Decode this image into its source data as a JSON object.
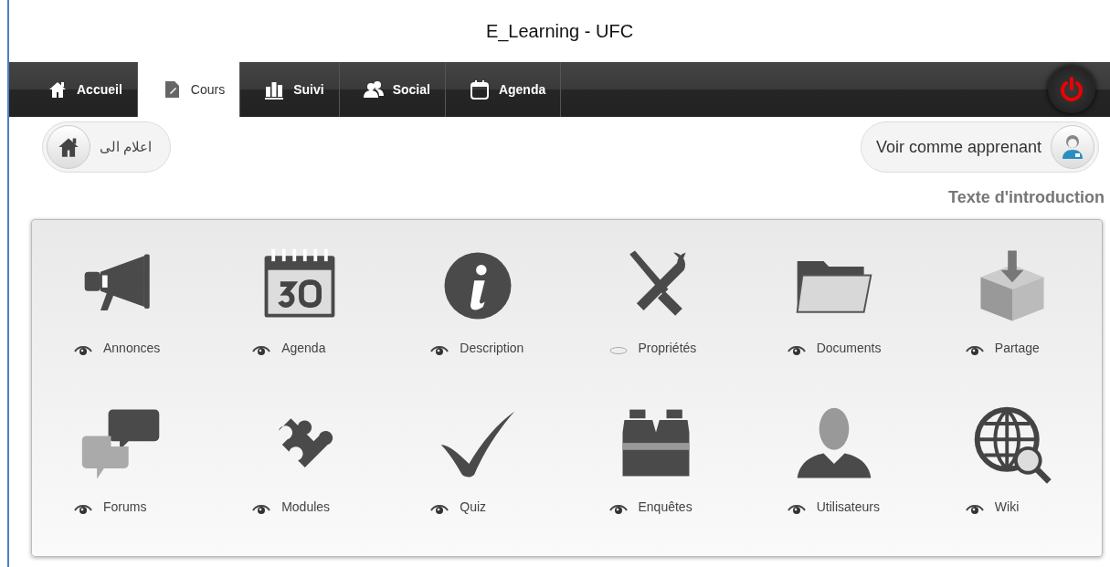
{
  "window": {
    "title": "E_Learning - UFC"
  },
  "nav": [
    {
      "label": "Accueil",
      "kind": "home",
      "selected": false
    },
    {
      "label": "Cours",
      "kind": "doc",
      "selected": true
    },
    {
      "label": "Suivi",
      "kind": "bars",
      "selected": false
    },
    {
      "label": "Social",
      "kind": "people",
      "selected": false
    },
    {
      "label": "Agenda",
      "kind": "calendar",
      "selected": false
    }
  ],
  "home_button": {
    "label": "اعلام الى"
  },
  "learner_button": {
    "label": "Voir comme apprenant"
  },
  "intro_link": "Texte d'introduction",
  "tools": [
    {
      "label": "Annonces",
      "kind": "megaphone",
      "visible": true
    },
    {
      "label": "Agenda",
      "kind": "calendar",
      "visible": true
    },
    {
      "label": "Description",
      "kind": "info",
      "visible": true
    },
    {
      "label": "Propriétés",
      "kind": "tools",
      "visible": false
    },
    {
      "label": "Documents",
      "kind": "folder",
      "visible": true
    },
    {
      "label": "Partage",
      "kind": "box",
      "visible": true
    },
    {
      "label": "Forums",
      "kind": "chat",
      "visible": true
    },
    {
      "label": "Modules",
      "kind": "puzzle",
      "visible": true
    },
    {
      "label": "Quiz",
      "kind": "check",
      "visible": true
    },
    {
      "label": "Enquêtes",
      "kind": "binoculars",
      "visible": true
    },
    {
      "label": "Utilisateurs",
      "kind": "user",
      "visible": true
    },
    {
      "label": "Wiki",
      "kind": "globe",
      "visible": true
    }
  ]
}
